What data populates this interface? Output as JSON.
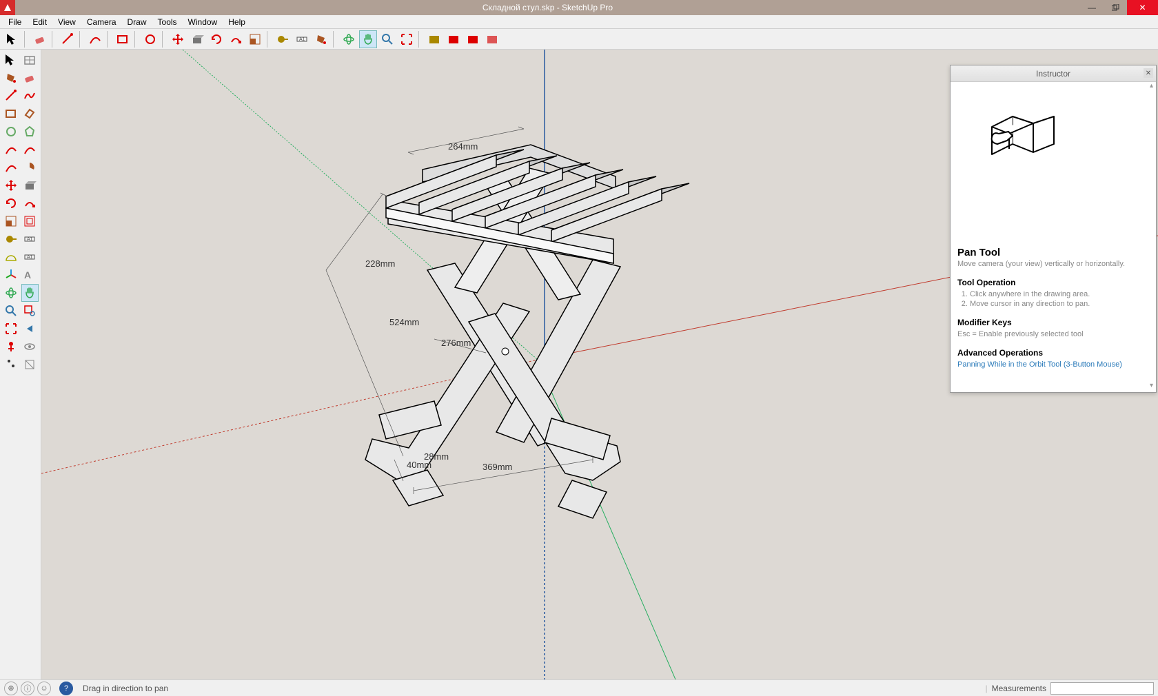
{
  "window": {
    "title": "Складной стул.skp - SketchUp Pro"
  },
  "menu": [
    "File",
    "Edit",
    "View",
    "Camera",
    "Draw",
    "Tools",
    "Window",
    "Help"
  ],
  "toolbar_top": [
    {
      "n": "select-tool",
      "c": "#000"
    },
    {
      "n": "sep"
    },
    {
      "n": "eraser-tool",
      "c": "#d66"
    },
    {
      "n": "sep"
    },
    {
      "n": "line-tool",
      "c": "#d00"
    },
    {
      "n": "sep"
    },
    {
      "n": "arc-tool",
      "c": "#d00"
    },
    {
      "n": "sep"
    },
    {
      "n": "rectangle-tool",
      "c": "#d00"
    },
    {
      "n": "sep"
    },
    {
      "n": "circle-tool",
      "c": "#d00"
    },
    {
      "n": "sep"
    },
    {
      "n": "move-tool",
      "c": "#d00"
    },
    {
      "n": "push-pull-tool",
      "c": "#777"
    },
    {
      "n": "rotate-tool",
      "c": "#d00"
    },
    {
      "n": "follow-me-tool",
      "c": "#d00"
    },
    {
      "n": "scale-tool",
      "c": "#a52"
    },
    {
      "n": "sep"
    },
    {
      "n": "tape-measure-tool",
      "c": "#a80"
    },
    {
      "n": "dimension-tool",
      "c": "#555"
    },
    {
      "n": "paint-bucket-tool",
      "c": "#a52"
    },
    {
      "n": "sep"
    },
    {
      "n": "orbit-tool",
      "c": "#3a5"
    },
    {
      "n": "pan-tool",
      "c": "#3a5",
      "active": true
    },
    {
      "n": "zoom-tool",
      "c": "#37a"
    },
    {
      "n": "zoom-extents-tool",
      "c": "#d00"
    },
    {
      "n": "sep"
    },
    {
      "n": "get-models-tool",
      "c": "#a80"
    },
    {
      "n": "share-model-tool",
      "c": "#d00"
    },
    {
      "n": "extension-warehouse-tool",
      "c": "#d00"
    },
    {
      "n": "layout-tool",
      "c": "#d55"
    }
  ],
  "left_toolbar": [
    [
      {
        "n": "select",
        "c": "#000"
      },
      {
        "n": "make-component",
        "c": "#888"
      }
    ],
    [
      {
        "n": "paint-bucket",
        "c": "#a52"
      },
      {
        "n": "eraser",
        "c": "#d66"
      }
    ],
    [
      {
        "n": "line",
        "c": "#d00"
      },
      {
        "n": "freehand",
        "c": "#d00"
      }
    ],
    [
      {
        "n": "rectangle",
        "c": "#a52"
      },
      {
        "n": "rotated-rectangle",
        "c": "#a52"
      }
    ],
    [
      {
        "n": "circle",
        "c": "#6a6"
      },
      {
        "n": "polygon",
        "c": "#6a6"
      }
    ],
    [
      {
        "n": "arc",
        "c": "#d00"
      },
      {
        "n": "2point-arc",
        "c": "#d00"
      }
    ],
    [
      {
        "n": "3point-arc",
        "c": "#d00"
      },
      {
        "n": "pie",
        "c": "#a52"
      }
    ],
    [
      {
        "n": "move",
        "c": "#d00"
      },
      {
        "n": "push-pull",
        "c": "#777"
      }
    ],
    [
      {
        "n": "rotate",
        "c": "#d00"
      },
      {
        "n": "follow-me",
        "c": "#d00"
      }
    ],
    [
      {
        "n": "scale",
        "c": "#a52"
      },
      {
        "n": "offset",
        "c": "#d00"
      }
    ],
    [
      {
        "n": "tape-measure",
        "c": "#a80"
      },
      {
        "n": "dimension",
        "c": "#555"
      }
    ],
    [
      {
        "n": "protractor",
        "c": "#aa0"
      },
      {
        "n": "text",
        "c": "#555"
      }
    ],
    [
      {
        "n": "axes",
        "c": "#39d"
      },
      {
        "n": "3d-text",
        "c": "#888"
      }
    ],
    [
      {
        "n": "orbit",
        "c": "#3a5"
      },
      {
        "n": "pan",
        "c": "#3a5",
        "active": true
      }
    ],
    [
      {
        "n": "zoom",
        "c": "#37a"
      },
      {
        "n": "zoom-window",
        "c": "#d00"
      }
    ],
    [
      {
        "n": "zoom-extents",
        "c": "#d00"
      },
      {
        "n": "previous",
        "c": "#37a"
      }
    ],
    [
      {
        "n": "position-camera",
        "c": "#d00"
      },
      {
        "n": "look-around",
        "c": "#888"
      }
    ],
    [
      {
        "n": "walk",
        "c": "#333"
      },
      {
        "n": "section-plane",
        "c": "#888"
      }
    ]
  ],
  "dimensions": {
    "top": "264mm",
    "d228": "228mm",
    "d524": "524mm",
    "d276": "276mm",
    "d28": "28mm",
    "d40": "40mm",
    "d369": "369mm"
  },
  "instructor": {
    "title": "Instructor",
    "tool_name": "Pan Tool",
    "tool_desc": "Move camera (your view) vertically or horizontally.",
    "op_title": "Tool Operation",
    "op_items": [
      "Click anywhere in the drawing area.",
      "Move cursor in any direction to pan."
    ],
    "mod_title": "Modifier Keys",
    "mod_text": "Esc = Enable previously selected tool",
    "adv_title": "Advanced Operations",
    "adv_link": "Panning While in the Orbit Tool (3-Button Mouse)"
  },
  "status": {
    "hint": "Drag in direction to pan",
    "measurements_label": "Measurements"
  }
}
